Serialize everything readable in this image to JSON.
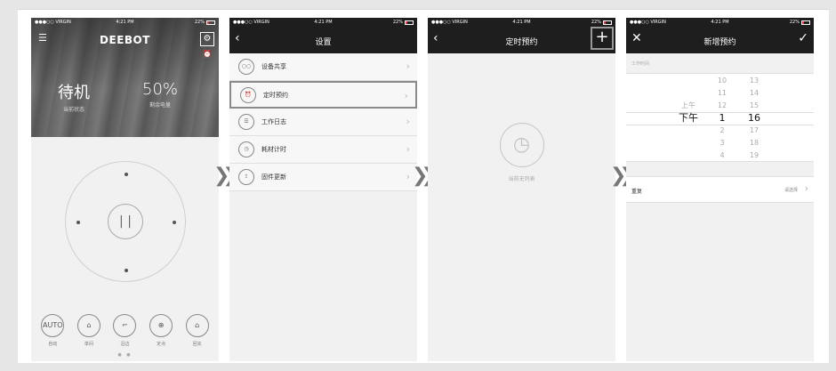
{
  "status": {
    "carrier": "●●●○○ VIRGIN",
    "time": "4:21 PM",
    "battery": "22%"
  },
  "screen1": {
    "brand": "DEEBOT",
    "state_value": "待机",
    "state_label": "当前状态",
    "battery_value": "50%",
    "battery_label": "剩余电量",
    "modes": [
      {
        "icon": "AUTO",
        "label": "自动"
      },
      {
        "icon": "⌂",
        "label": "单间"
      },
      {
        "icon": "⌐",
        "label": "沿边"
      },
      {
        "icon": "⊕",
        "label": "定点"
      },
      {
        "icon": "⌂",
        "label": "回充"
      }
    ]
  },
  "screen2": {
    "title": "设置",
    "items": [
      {
        "icon": "○○",
        "label": "设备共享"
      },
      {
        "icon": "⏰",
        "label": "定时预约"
      },
      {
        "icon": "☰",
        "label": "工作日志"
      },
      {
        "icon": "◷",
        "label": "耗材计时"
      },
      {
        "icon": "⇪",
        "label": "固件更新"
      }
    ]
  },
  "screen3": {
    "title": "定时预约",
    "empty_label": "当前无列表"
  },
  "screen4": {
    "title": "新增预约",
    "section_label": "工作时间",
    "ampm": [
      "",
      "",
      "上午",
      "下午",
      "",
      "",
      ""
    ],
    "hours": [
      "10",
      "11",
      "12",
      "1",
      "2",
      "3",
      "4"
    ],
    "minutes": [
      "13",
      "14",
      "15",
      "16",
      "17",
      "18",
      "19"
    ],
    "repeat_label": "重复",
    "repeat_value": "请选择"
  },
  "colors": {
    "navbar": "#1e1e1e",
    "highlight_border": "#8a8a8a"
  }
}
